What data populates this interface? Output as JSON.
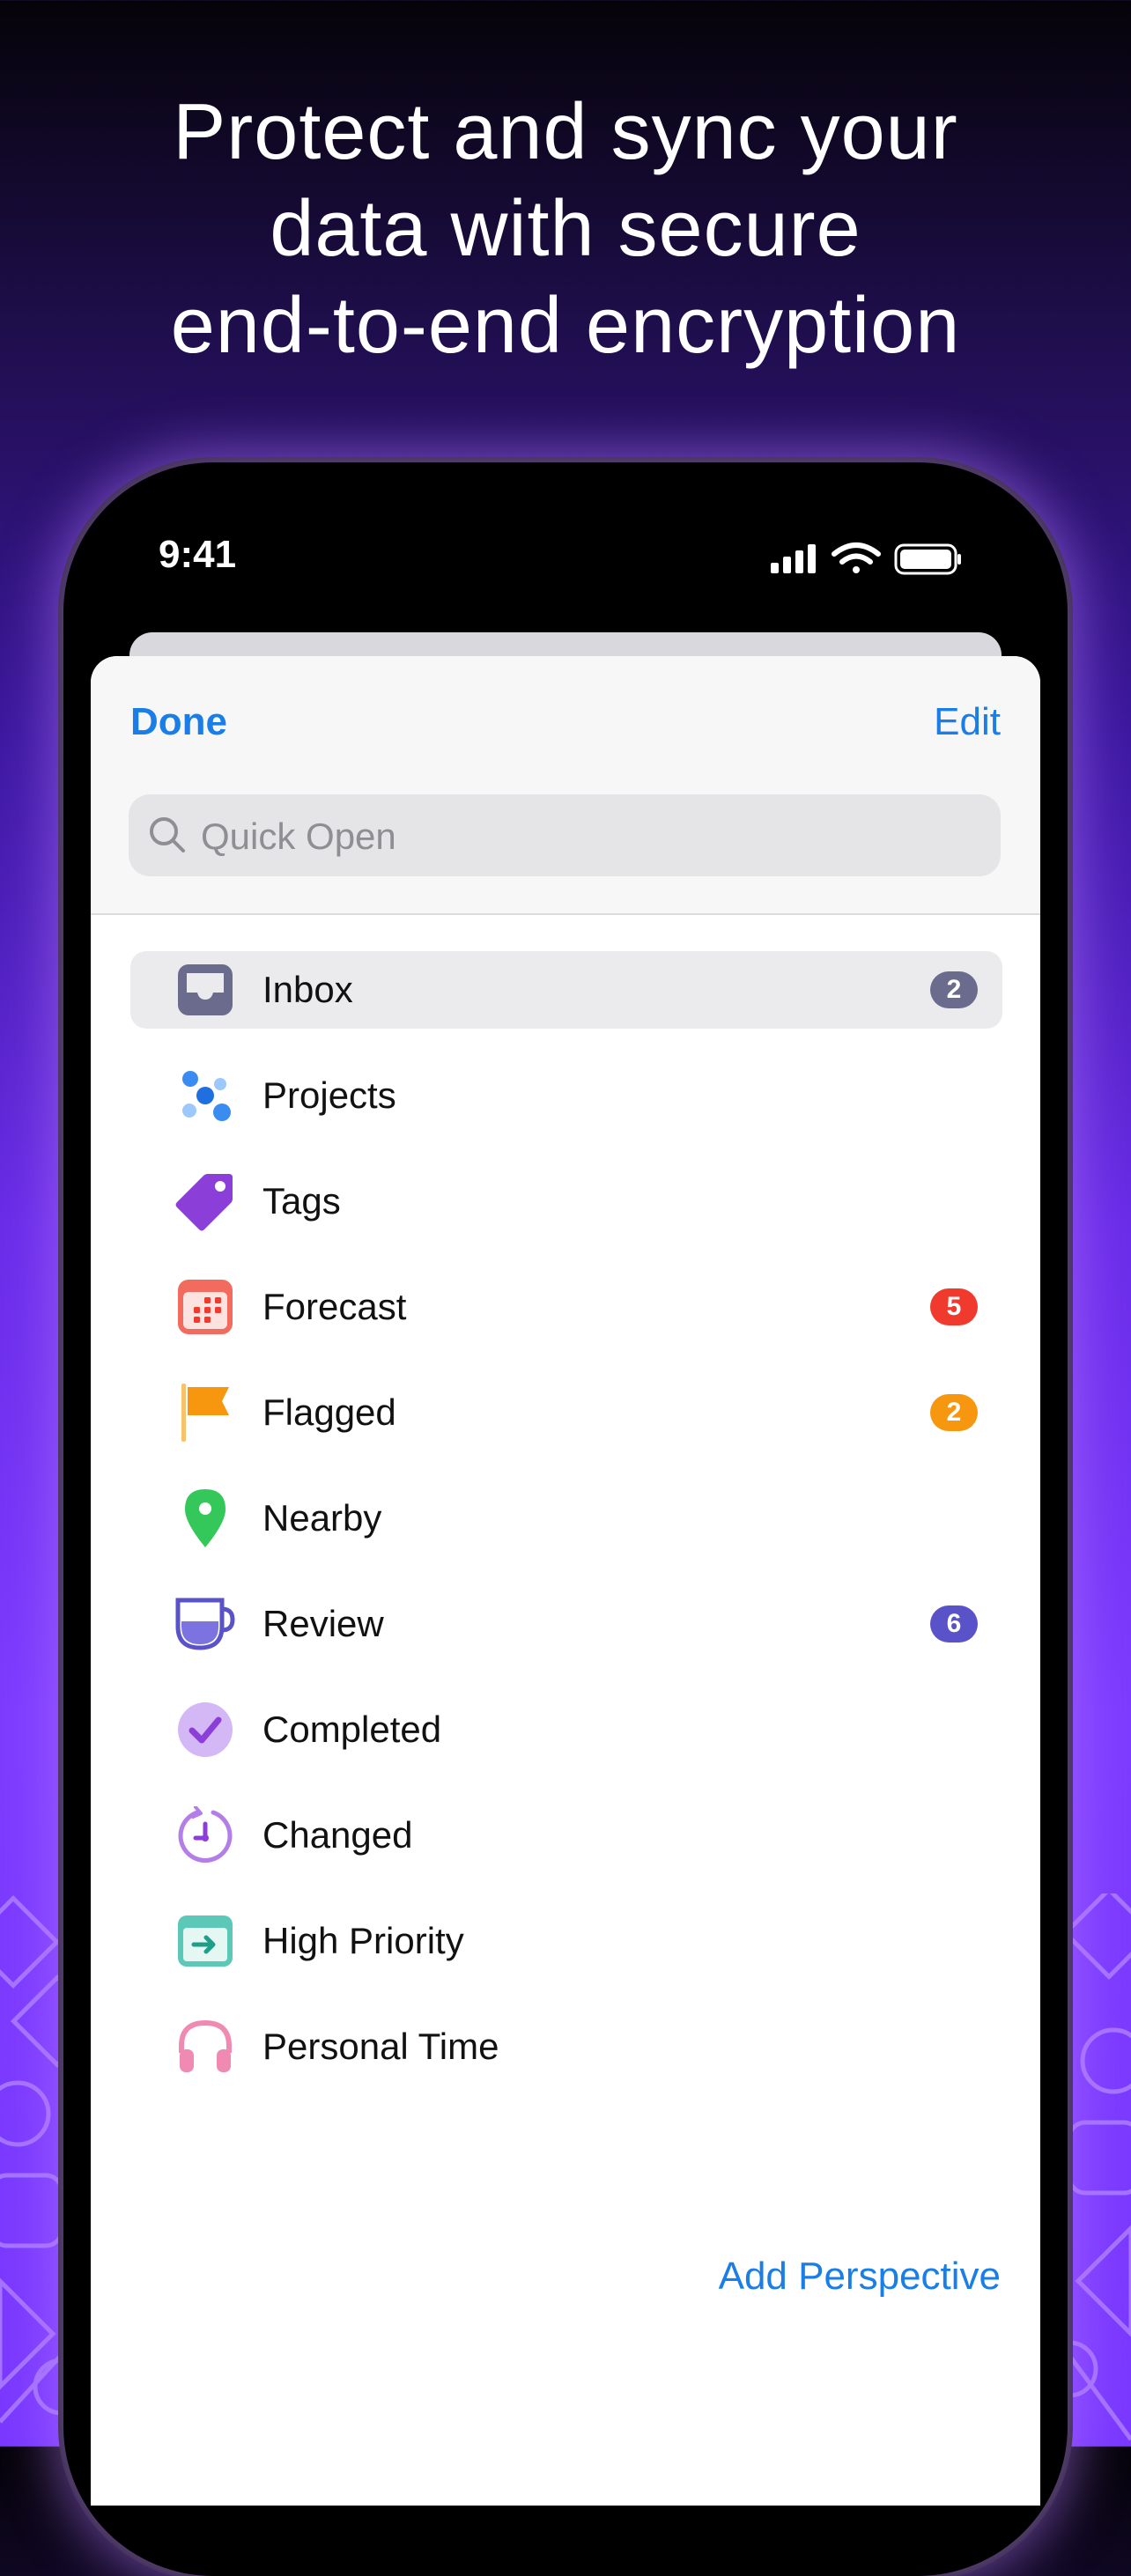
{
  "headline": {
    "lines": [
      "Protect and sync your",
      "data with secure",
      "end-to-end encryption"
    ]
  },
  "status_bar": {
    "time": "9:41",
    "icons": [
      "cellular-signal-icon",
      "wifi-icon",
      "battery-icon"
    ]
  },
  "sheet": {
    "done_label": "Done",
    "edit_label": "Edit",
    "search": {
      "placeholder": "Quick Open",
      "value": ""
    },
    "perspectives": [
      {
        "label": "Inbox",
        "icon": "inbox-icon",
        "badge": "2",
        "badge_color": "#6b6b8e",
        "selected": true
      },
      {
        "label": "Projects",
        "icon": "projects-icon",
        "badge": "",
        "badge_color": ""
      },
      {
        "label": "Tags",
        "icon": "tag-icon",
        "badge": "",
        "badge_color": ""
      },
      {
        "label": "Forecast",
        "icon": "calendar-icon",
        "badge": "5",
        "badge_color": "#f03a2e"
      },
      {
        "label": "Flagged",
        "icon": "flag-icon",
        "badge": "2",
        "badge_color": "#f7960f"
      },
      {
        "label": "Nearby",
        "icon": "location-pin-icon",
        "badge": "",
        "badge_color": ""
      },
      {
        "label": "Review",
        "icon": "coffee-cup-icon",
        "badge": "6",
        "badge_color": "#5a52c8"
      },
      {
        "label": "Completed",
        "icon": "checkmark-icon",
        "badge": "",
        "badge_color": ""
      },
      {
        "label": "Changed",
        "icon": "clock-arrow-icon",
        "badge": "",
        "badge_color": ""
      },
      {
        "label": "High Priority",
        "icon": "high-priority-icon",
        "badge": "",
        "badge_color": ""
      },
      {
        "label": "Personal Time",
        "icon": "headphones-icon",
        "badge": "",
        "badge_color": ""
      }
    ],
    "add_perspective_label": "Add Perspective"
  },
  "colors": {
    "accent_link": "#1a7ee6",
    "background_top": "#050308",
    "background_bottom": "#7a38ff"
  }
}
